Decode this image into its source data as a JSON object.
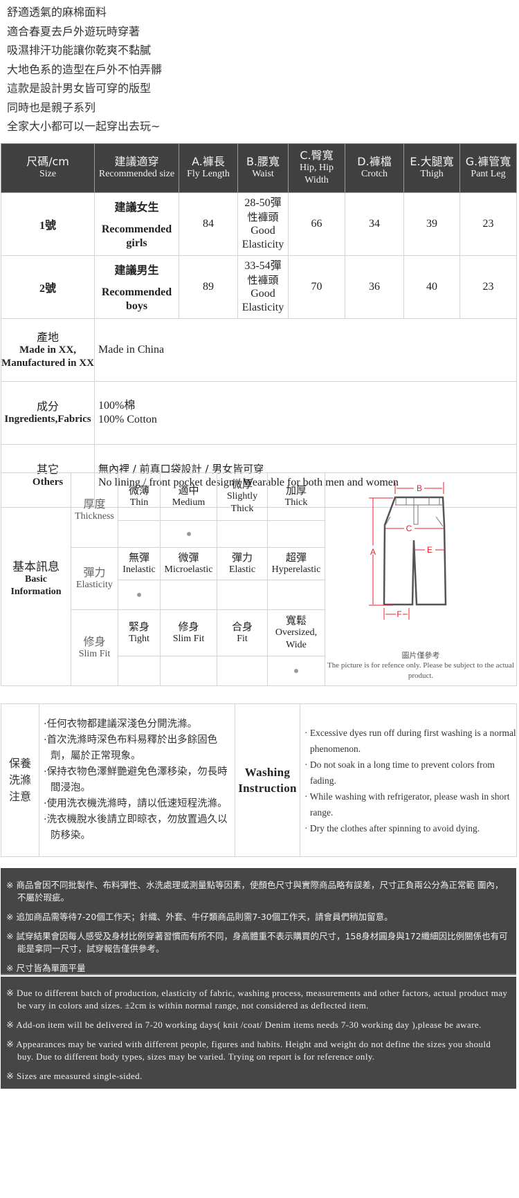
{
  "intro_lines": [
    "舒適透氣的麻棉面料",
    "適合春夏去戶外遊玩時穿著",
    "吸濕排汗功能讓你乾爽不黏膩",
    "大地色系的造型在戶外不怕弄髒",
    "這款是設計男女皆可穿的版型",
    "同時也是親子系列",
    "全家大小都可以一起穿出去玩~"
  ],
  "size_table": {
    "headers": [
      {
        "zh": "尺碼/cm",
        "en": "Size"
      },
      {
        "zh": "建議適穿",
        "en": "Recommended size"
      },
      {
        "zh": "A.褲長",
        "en": "Fly Length"
      },
      {
        "zh": "B.腰寬",
        "en": "Waist"
      },
      {
        "zh": "C.臀寬",
        "en": "Hip, Hip Width"
      },
      {
        "zh": "D.褲檔",
        "en": "Crotch"
      },
      {
        "zh": "E.大腿寬",
        "en": "Thigh"
      },
      {
        "zh": "G.褲管寬",
        "en": "Pant Leg"
      }
    ],
    "rows": [
      {
        "size": "1號",
        "rec_zh": "建議女生",
        "rec_en": "Recommended girls",
        "length": "84",
        "waist_range": "28-50彈",
        "waist_zh": "性褲頭",
        "waist_en": "Good Elasticity",
        "hip": "66",
        "crotch": "34",
        "thigh": "39",
        "leg": "23"
      },
      {
        "size": "2號",
        "rec_zh": "建議男生",
        "rec_en": "Recommended boys",
        "length": "89",
        "waist_range": "33-54彈",
        "waist_zh": "性褲頭",
        "waist_en": "Good Elasticity",
        "hip": "70",
        "crotch": "36",
        "thigh": "40",
        "leg": "23"
      }
    ],
    "made_in": {
      "label_zh": "產地",
      "label_en": "Made in XX, Manufactured in XX",
      "value": "Made in China"
    },
    "fabric": {
      "label_zh": "成分",
      "label_en": "Ingredients,Fabrics",
      "value_zh": "100%棉",
      "value_en": "100% Cotton"
    },
    "others": {
      "label_zh": "其它",
      "label_en": "Others",
      "value_zh": "無內裡 / 前真口袋設計 / 男女皆可穿",
      "value_en": "No lining / front pocket design / Wearable for both men and women"
    }
  },
  "basic_info": {
    "label_zh": "基本訊息",
    "label_en": "Basic Information",
    "thickness": {
      "zh": "厚度",
      "en": "Thickness",
      "options": [
        {
          "zh": "微薄",
          "en": "Thin"
        },
        {
          "zh": "適中",
          "en": "Medium"
        },
        {
          "zh": "微厚",
          "en": "Slightly Thick"
        },
        {
          "zh": "加厚",
          "en": "Thick"
        }
      ],
      "selected_index": 1
    },
    "elasticity": {
      "zh": "彈力",
      "en": "Elasticity",
      "options": [
        {
          "zh": "無彈",
          "en": "Inelastic"
        },
        {
          "zh": "微彈",
          "en": "Microelastic"
        },
        {
          "zh": "彈力",
          "en": "Elastic"
        },
        {
          "zh": "超彈",
          "en": "Hyperelastic"
        }
      ],
      "selected_index": 0
    },
    "fit": {
      "zh": "修身",
      "en": "Slim Fit",
      "options": [
        {
          "zh": "緊身",
          "en": "Tight"
        },
        {
          "zh": "修身",
          "en": "Slim Fit"
        },
        {
          "zh": "合身",
          "en": "Fit"
        },
        {
          "zh": "寬鬆",
          "en": "Oversized, Wide"
        }
      ],
      "selected_index": 3
    },
    "diagram": {
      "labels": [
        "A",
        "B",
        "C",
        "E",
        "F"
      ],
      "line_color": "#e8202a",
      "caption_zh": "圖片僅參考",
      "caption_en": "The picture is for refence only. Please be subject to the actual product."
    }
  },
  "washing": {
    "label_zh": "保養洗滌注意",
    "label_en": "Washing Instruction",
    "items_zh": [
      "·任何衣物都建議深淺色分開洗滌。",
      "·首次洗滌時深色布料易釋於出多餘固色劑，屬於正常現象。",
      "·保持衣物色澤鮮艷避免色澤移染，勿長時間浸泡。",
      "·使用洗衣機洗滌時，請以低速短程洗滌。",
      "·洗衣機脫水後請立即晾衣，勿放置過久以防移染。"
    ],
    "items_en": [
      "· Excessive dyes run off during first washing is a normal phenomenon.",
      "· Do not soak in a long time to prevent colors from fading.",
      "· While washing with refrigerator, please wash in short range.",
      "· Dry the clothes after spinning to avoid dying."
    ]
  },
  "notes_zh": [
    "※ 商品會因不同批製作、布料彈性、水洗處理或測量點等因素，使顏色尺寸與實際商品略有誤差，尺寸正負兩公分為正常範 圍內，不屬於瑕疵。",
    "※ 追加商品需等待7-20個工作天；針織、外套、牛仔類商品則需7-30個工作天，請會員們稍加留意。",
    "※ 試穿結果會因每人感受及身材比例穿著習慣而有所不同，身高體重不表示購買的尺寸，158身材圓身與172纖細因比例關係也有可能是拿同一尺寸，試穿報告僅供參考。",
    "※ 尺寸皆為單面平量"
  ],
  "notes_en": [
    "※ Due to different batch of production, elasticity of fabric, washing process, measurements and other factors, actual product may be vary in colors and sizes. ±2cm is within normal range, not considered as deflected item.",
    "※ Add-on item will be delivered in 7-20 working days( knit /coat/ Denim items needs 7-30 working day ),please be aware.",
    "※ Appearances may be varied with different people, figures and habits. Height and weight do not define the sizes you should buy. Due to different body types, sizes may be varied. Trying on report is for reference only.",
    "※ Sizes are measured single-sided."
  ],
  "colors": {
    "header_bg": "#404040",
    "notes_bg": "#464646",
    "border": "#d4d4d4",
    "dot": "#9a9a9a",
    "diagram_red": "#e8202a"
  }
}
